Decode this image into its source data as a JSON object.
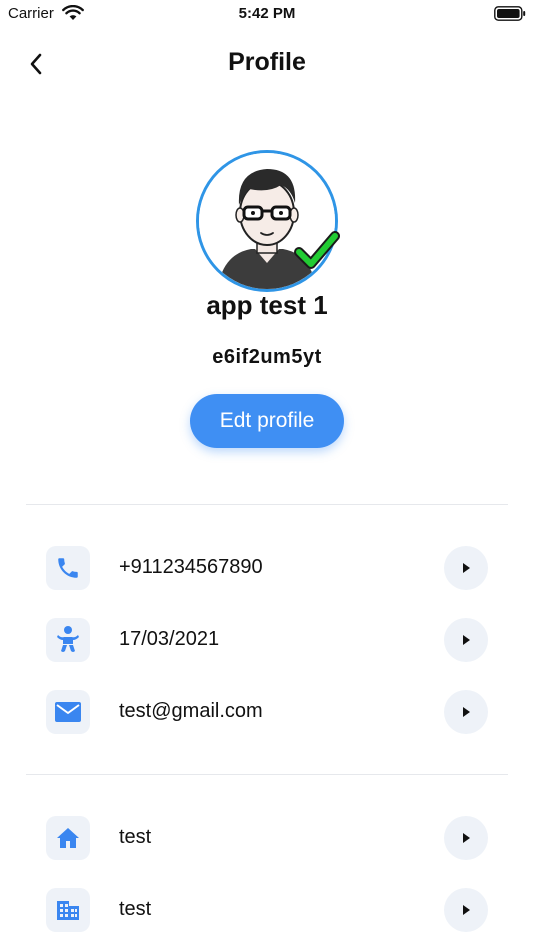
{
  "status_bar": {
    "carrier": "Carrier",
    "time": "5:42 PM"
  },
  "nav": {
    "title": "Profile",
    "back_icon": "chevron-left-icon"
  },
  "profile": {
    "name": "app test 1",
    "code": "e6if2um5yt",
    "edit_label": "Edt profile",
    "verified": true
  },
  "contact_items": [
    {
      "icon": "phone-icon",
      "value": "+911234567890"
    },
    {
      "icon": "baby-icon",
      "value": "17/03/2021"
    },
    {
      "icon": "email-icon",
      "value": "test@gmail.com"
    }
  ],
  "address_items": [
    {
      "icon": "home-icon",
      "value": "test"
    },
    {
      "icon": "building-icon",
      "value": "test"
    }
  ],
  "colors": {
    "accent": "#3f8ff3",
    "ring": "#2f95e6",
    "check": "#22cc33",
    "icon_bg": "#eef2f8",
    "icon": "#3a86f0"
  }
}
